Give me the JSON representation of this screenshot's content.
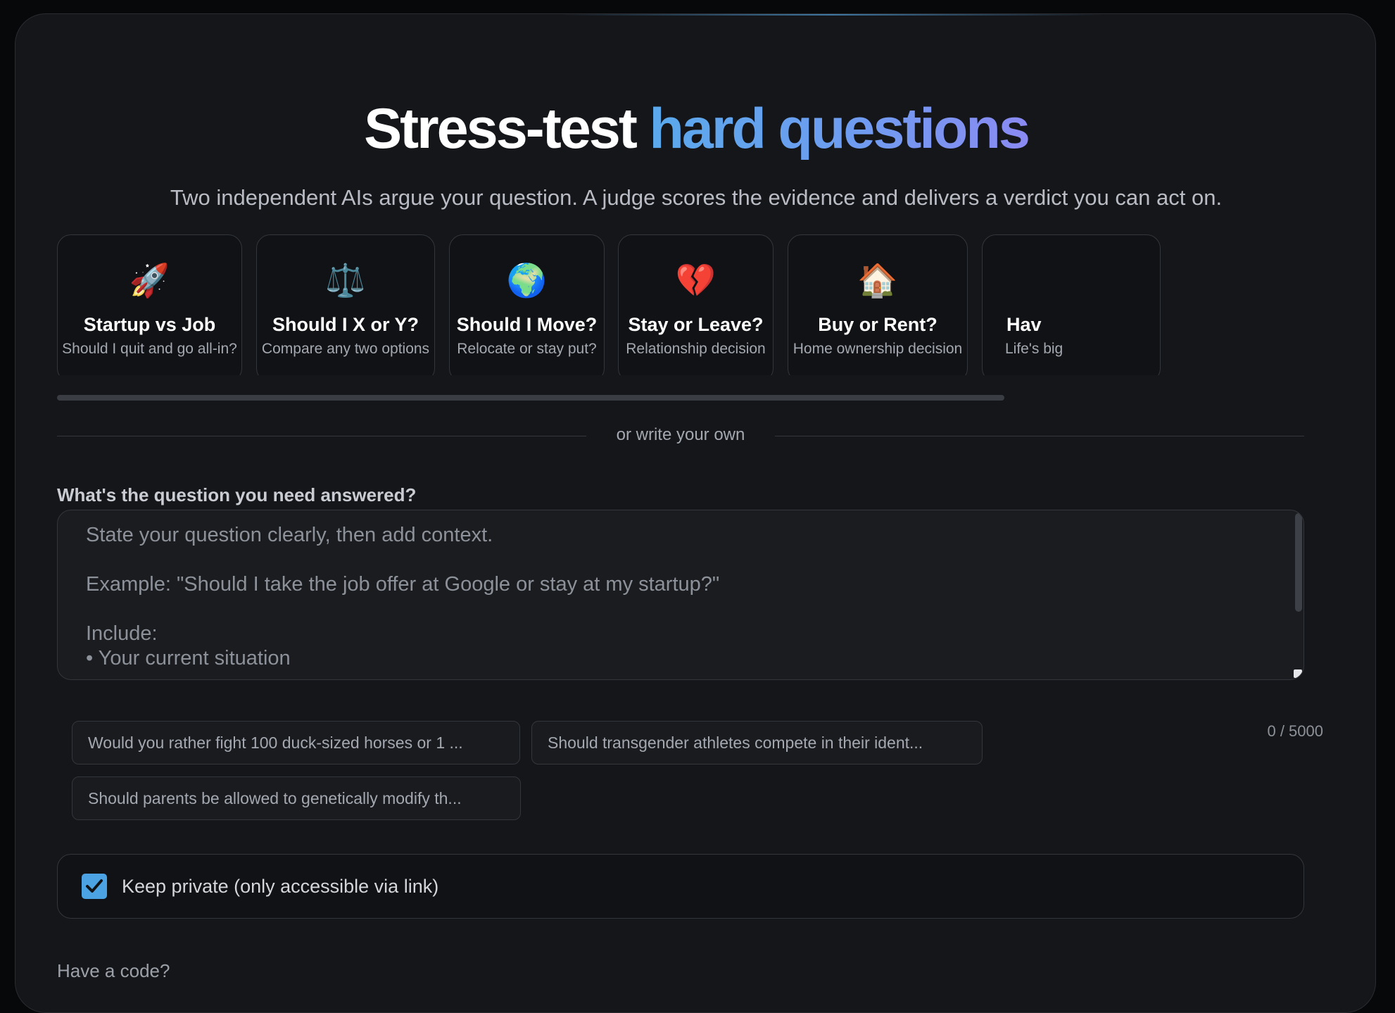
{
  "hero": {
    "title_plain": "Stress-test",
    "title_accent": "hard questions",
    "subtitle": "Two independent AIs argue your question. A judge scores the evidence and delivers a verdict you can act on."
  },
  "templates": [
    {
      "icon": "rocket-icon",
      "emoji": "🚀",
      "title": "Startup vs Job",
      "subtitle": "Should I quit and go all-in?"
    },
    {
      "icon": "scales-icon",
      "emoji": "⚖️",
      "title": "Should I X or Y?",
      "subtitle": "Compare any two options"
    },
    {
      "icon": "globe-icon",
      "emoji": "🌍",
      "title": "Should I Move?",
      "subtitle": "Relocate or stay put?"
    },
    {
      "icon": "broken-heart-icon",
      "emoji": "💔",
      "title": "Stay or Leave?",
      "subtitle": "Relationship decision"
    },
    {
      "icon": "house-icon",
      "emoji": "🏠",
      "title": "Buy or Rent?",
      "subtitle": "Home ownership decision"
    },
    {
      "icon": "partial-card-icon",
      "emoji": "",
      "title": "Hav",
      "subtitle": "Life's big"
    }
  ],
  "divider_text": "or write your own",
  "question": {
    "label": "What's the question you need answered?",
    "value": "",
    "placeholder": "State your question clearly, then add context.\n\nExample: \"Should I take the job offer at Google or stay at my startup?\"\n\nInclude:\n• Your current situation",
    "char_count": "0 / 5000"
  },
  "suggestions": [
    "Would you rather fight 100 duck-sized horses or 1 ...",
    "Should transgender athletes compete in their ident...",
    "Should parents be allowed to genetically modify th..."
  ],
  "privacy": {
    "label": "Keep private (only accessible via link)",
    "checked": true
  },
  "code_link": "Have a code?",
  "colors": {
    "background": "#07080a",
    "panel": "#151619",
    "accent_start": "#5aa9ec",
    "accent_end": "#8a8af2",
    "checkbox": "#4ba3e4"
  }
}
